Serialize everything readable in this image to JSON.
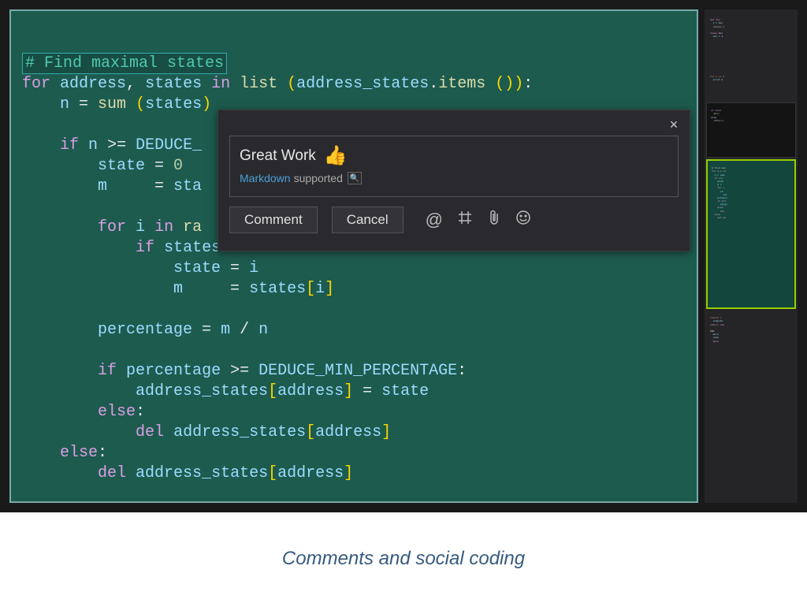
{
  "caption": "Comments and social coding",
  "code": {
    "line1_comment": "# Find maximal states",
    "line2": {
      "for": "for",
      "address": "address",
      "states": "states",
      "in": "in",
      "list": "list",
      "address_states": "address_states",
      "items": "items"
    },
    "line3": {
      "n": "n",
      "sum": "sum",
      "states": "states"
    },
    "line5": {
      "if": "if",
      "n": "n",
      "deduce": "DEDUCE_"
    },
    "line6": {
      "state": "state",
      "zero": "0"
    },
    "line7": {
      "m": "m",
      "sta": "sta"
    },
    "line9": {
      "for": "for",
      "i": "i",
      "in": "in",
      "ra": "ra"
    },
    "line10": {
      "if": "if",
      "states": "states"
    },
    "line11": {
      "state": "state",
      "i": "i"
    },
    "line12": {
      "m": "m",
      "states": "states",
      "i": "i"
    },
    "line14": {
      "percentage": "percentage",
      "m": "m",
      "n": "n"
    },
    "line16": {
      "if": "if",
      "percentage": "percentage",
      "deduce": "DEDUCE_MIN_PERCENTAGE"
    },
    "line17": {
      "address_states": "address_states",
      "address": "address",
      "state": "state"
    },
    "line18": {
      "else": "else"
    },
    "line19": {
      "del": "del",
      "address_states": "address_states",
      "address": "address"
    },
    "line20": {
      "else": "else"
    },
    "line21": {
      "del": "del",
      "address_states": "address_states",
      "address": "address"
    }
  },
  "dialog": {
    "comment_text": "Great Work",
    "thumb_emoji": "👍",
    "markdown_label": "Markdown",
    "supported_label": "supported",
    "comment_btn": "Comment",
    "cancel_btn": "Cancel",
    "close": "×",
    "at": "@",
    "hash": "#",
    "clip": "📎",
    "smile": "☺"
  }
}
